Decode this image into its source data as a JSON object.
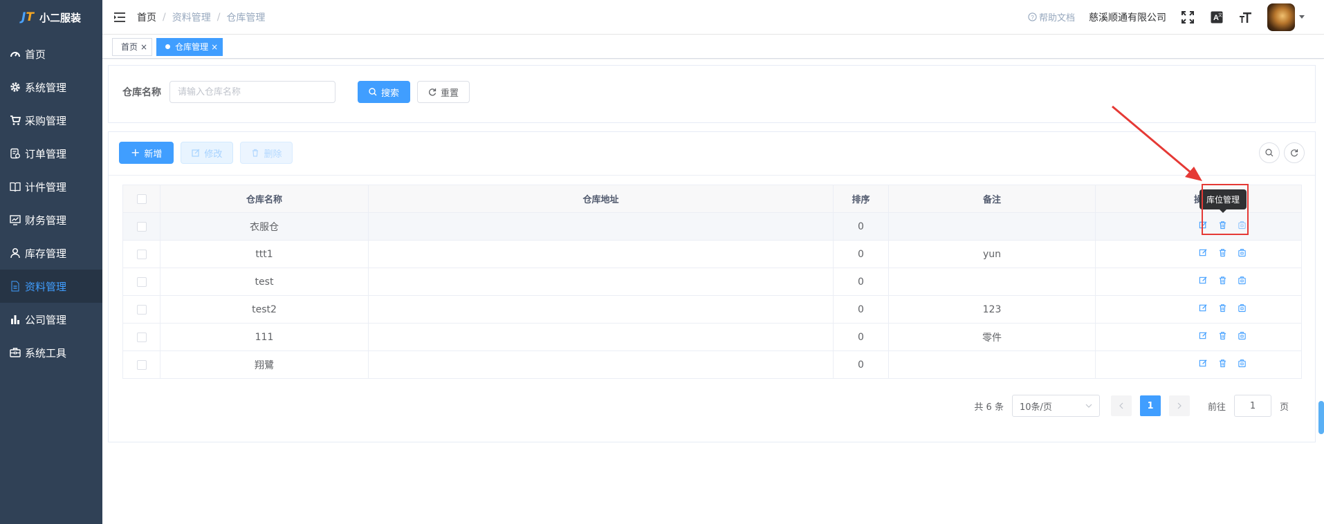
{
  "app": {
    "logo_text": "小二服装",
    "logo_mark_a": "J",
    "logo_mark_b": "T"
  },
  "sidebar": {
    "items": [
      {
        "label": "首页",
        "icon": "dashboard-icon"
      },
      {
        "label": "系统管理",
        "icon": "gear-icon"
      },
      {
        "label": "采购管理",
        "icon": "cart-icon"
      },
      {
        "label": "订单管理",
        "icon": "order-icon"
      },
      {
        "label": "计件管理",
        "icon": "book-icon"
      },
      {
        "label": "财务管理",
        "icon": "chart-board-icon"
      },
      {
        "label": "库存管理",
        "icon": "user-icon"
      },
      {
        "label": "资料管理",
        "icon": "document-icon",
        "active": true
      },
      {
        "label": "公司管理",
        "icon": "bar-chart-icon"
      },
      {
        "label": "系统工具",
        "icon": "toolbox-icon"
      }
    ]
  },
  "navbar": {
    "breadcrumb": [
      "首页",
      "资料管理",
      "仓库管理"
    ],
    "help": "帮助文档",
    "company": "慈溪顺通有限公司"
  },
  "tags": [
    {
      "label": "首页",
      "active": false
    },
    {
      "label": "仓库管理",
      "active": true
    }
  ],
  "search": {
    "label": "仓库名称",
    "placeholder": "请输入仓库名称",
    "search_btn": "搜索",
    "reset_btn": "重置"
  },
  "toolbar": {
    "add": "新增",
    "edit": "修改",
    "delete": "删除"
  },
  "table": {
    "columns": [
      "仓库名称",
      "仓库地址",
      "排序",
      "备注",
      "操作"
    ],
    "header_last_visible": "操",
    "rows": [
      {
        "name": "衣服仓",
        "address": "",
        "sort": "0",
        "remark": ""
      },
      {
        "name": "ttt1",
        "address": "",
        "sort": "0",
        "remark": "yun"
      },
      {
        "name": "test",
        "address": "",
        "sort": "0",
        "remark": ""
      },
      {
        "name": "test2",
        "address": "",
        "sort": "0",
        "remark": "123"
      },
      {
        "name": "111",
        "address": "",
        "sort": "0",
        "remark": "零件"
      },
      {
        "name": "翔鷺",
        "address": "",
        "sort": "0",
        "remark": ""
      }
    ]
  },
  "tooltip": {
    "text": "库位管理"
  },
  "pager": {
    "total_text": "共 6 条",
    "page_size": "10条/页",
    "current_page": "1",
    "goto_label": "前往",
    "goto_value": "1",
    "goto_suffix": "页"
  },
  "colors": {
    "sidebar_bg": "#304156",
    "primary": "#409eff",
    "annotation_red": "#e53935"
  }
}
